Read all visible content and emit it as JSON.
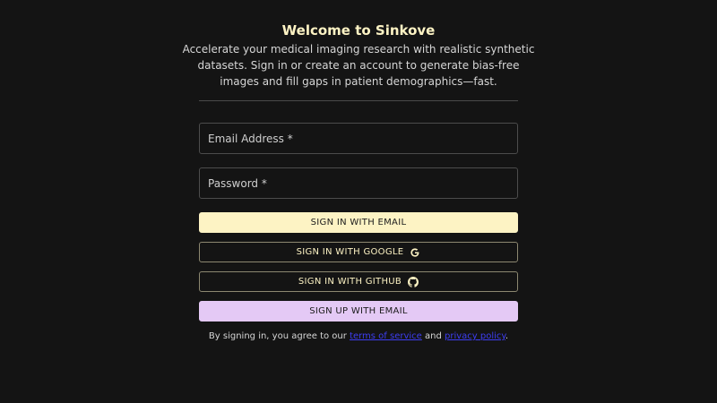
{
  "header": {
    "title": "Welcome to Sinkove",
    "subtitle": "Accelerate your medical imaging research with realistic synthetic datasets. Sign in or create an account to generate bias-free images and fill gaps in patient demographics—fast."
  },
  "form": {
    "email_placeholder": "Email Address *",
    "email_value": "",
    "password_placeholder": "Password *",
    "password_value": ""
  },
  "buttons": {
    "sign_in_email": "SIGN IN WITH EMAIL",
    "sign_in_google": "SIGN IN WITH GOOGLE",
    "sign_in_github": "SIGN IN WITH GITHUB",
    "sign_up_email": "SIGN UP WITH EMAIL"
  },
  "icons": {
    "google": "google-icon",
    "github": "github-icon"
  },
  "legal": {
    "prefix": "By signing in, you agree to our ",
    "terms_link": "terms of service",
    "conjunction": " and ",
    "privacy_link": "privacy policy",
    "suffix": "."
  },
  "colors": {
    "background": "#141414",
    "accent_yellow": "#fdf3c4",
    "accent_lavender": "#e4c9f5",
    "link": "#3d3df2"
  }
}
